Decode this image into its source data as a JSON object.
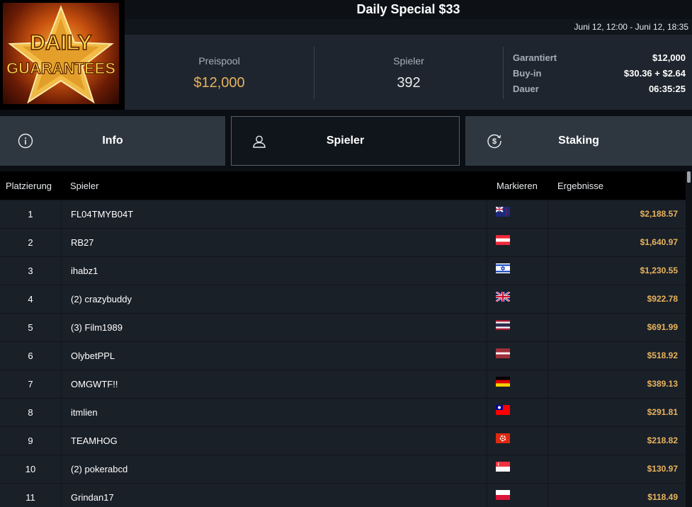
{
  "logo": {
    "line1": "DAILY",
    "line2": "GUARANTEES"
  },
  "title": "Daily Special $33",
  "date_range": "Juni 12, 12:00 - Juni 12, 18:35",
  "stats": {
    "prize_pool_label": "Preispool",
    "prize_pool_value": "$12,000",
    "players_label": "Spieler",
    "players_value": "392",
    "details": [
      {
        "label": "Garantiert",
        "value": "$12,000"
      },
      {
        "label": "Buy-in",
        "value": "$30.36 + $2.64"
      },
      {
        "label": "Dauer",
        "value": "06:35:25"
      }
    ]
  },
  "tabs": [
    {
      "label": "Info",
      "icon": "info-icon"
    },
    {
      "label": "Spieler",
      "icon": "user-icon"
    },
    {
      "label": "Staking",
      "icon": "dollar-coin-icon"
    }
  ],
  "table": {
    "headers": {
      "rank": "Platzierung",
      "player": "Spieler",
      "flag": "Markieren",
      "result": "Ergebnisse"
    },
    "rows": [
      {
        "rank": "1",
        "player": "FL04TMYB04T",
        "flag": "nz",
        "result": "$2,188.57"
      },
      {
        "rank": "2",
        "player": "RB27",
        "flag": "at",
        "result": "$1,640.97"
      },
      {
        "rank": "3",
        "player": "ihabz1",
        "flag": "il",
        "result": "$1,230.55"
      },
      {
        "rank": "4",
        "player": "(2) crazybuddy",
        "flag": "gb",
        "result": "$922.78"
      },
      {
        "rank": "5",
        "player": "(3) Film1989",
        "flag": "th",
        "result": "$691.99"
      },
      {
        "rank": "6",
        "player": "OlybetPPL",
        "flag": "lv",
        "result": "$518.92"
      },
      {
        "rank": "7",
        "player": "OMGWTF!!",
        "flag": "de",
        "result": "$389.13"
      },
      {
        "rank": "8",
        "player": "itmlien",
        "flag": "tw",
        "result": "$291.81"
      },
      {
        "rank": "9",
        "player": "TEAMHOG",
        "flag": "hk",
        "result": "$218.82"
      },
      {
        "rank": "10",
        "player": "(2) pokerabcd",
        "flag": "sg",
        "result": "$130.97"
      },
      {
        "rank": "11",
        "player": "Grindan17",
        "flag": "pl",
        "result": "$118.49"
      }
    ]
  },
  "colors": {
    "accent_gold": "#e9b35d",
    "panel": "#1e252e",
    "tab": "#2e3740",
    "row": "#1a2028"
  }
}
